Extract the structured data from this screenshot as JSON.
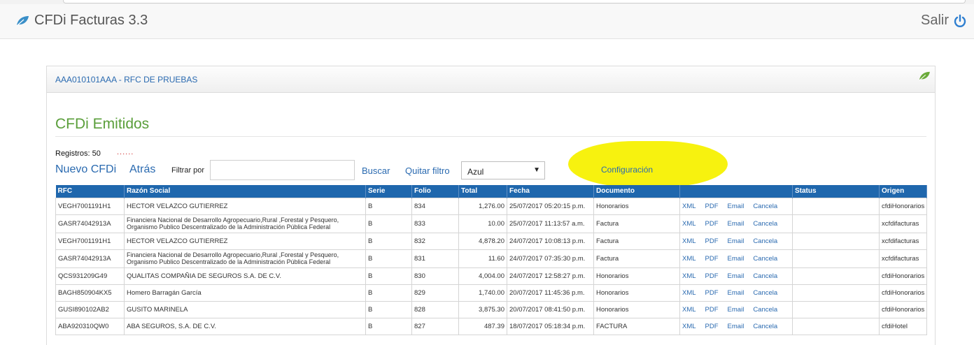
{
  "app": {
    "title": "CFDi Facturas 3.3",
    "logout_label": "Salir"
  },
  "panel": {
    "rfc_label": "AAA010101AAA - RFC DE PRUEBAS"
  },
  "section": {
    "title": "CFDi Emitidos",
    "registros": "Registros: 50",
    "dots": "......"
  },
  "toolbar": {
    "nuevo_label": "Nuevo CFDi",
    "atras_label": "Atrás",
    "filtrar_label": "Filtrar por",
    "filter_value": "",
    "buscar_label": "Buscar",
    "quitar_label": "Quitar filtro",
    "select_value": "Azul",
    "config_label": "Configuración"
  },
  "colors": {
    "accent": "#2a6ab0",
    "header_bg": "#1f67ad",
    "title_green": "#5a9e3a",
    "highlight": "#f7f20f"
  },
  "table": {
    "columns": [
      "RFC",
      "Razón Social",
      "Serie",
      "Folio",
      "Total",
      "Fecha",
      "Documento",
      "",
      "Status",
      "Origen"
    ],
    "actions": [
      "XML",
      "PDF",
      "Email",
      "Cancela"
    ],
    "rows": [
      {
        "rfc": "VEGH7001191H1",
        "razon": "HECTOR VELAZCO GUTIERREZ",
        "serie": "B",
        "folio": "834",
        "total": "1,276.00",
        "fecha": "25/07/2017 05:20:15 p.m.",
        "documento": "Honorarios",
        "status": "",
        "origen": "cfdiHonorarios"
      },
      {
        "rfc": "GASR74042913A",
        "razon": "Financiera Nacional de Desarrollo Agropecuario,Rural ,Forestal y Pesquero, Organismo Publico Descentralizado de la Administración Pública Federal",
        "serie": "B",
        "folio": "833",
        "total": "10.00",
        "fecha": "25/07/2017 11:13:57 a.m.",
        "documento": "Factura",
        "status": "",
        "origen": "xcfdifacturas"
      },
      {
        "rfc": "VEGH7001191H1",
        "razon": "HECTOR VELAZCO GUTIERREZ",
        "serie": "B",
        "folio": "832",
        "total": "4,878.20",
        "fecha": "24/07/2017 10:08:13 p.m.",
        "documento": "Factura",
        "status": "",
        "origen": "xcfdifacturas"
      },
      {
        "rfc": "GASR74042913A",
        "razon": "Financiera Nacional de Desarrollo Agropecuario,Rural ,Forestal y Pesquero, Organismo Publico Descentralizado de la Administración Pública Federal",
        "serie": "B",
        "folio": "831",
        "total": "11.60",
        "fecha": "24/07/2017 07:35:30 p.m.",
        "documento": "Factura",
        "status": "",
        "origen": "xcfdifacturas"
      },
      {
        "rfc": "QCS931209G49",
        "razon": "QUALITAS COMPAÑIA DE SEGUROS S.A. DE C.V.",
        "serie": "B",
        "folio": "830",
        "total": "4,004.00",
        "fecha": "24/07/2017 12:58:27 p.m.",
        "documento": "Honorarios",
        "status": "",
        "origen": "cfdiHonorarios"
      },
      {
        "rfc": "BAGH850904KX5",
        "razon": "Homero Barragán García",
        "serie": "B",
        "folio": "829",
        "total": "1,740.00",
        "fecha": "20/07/2017 11:45:36 p.m.",
        "documento": "Honorarios",
        "status": "",
        "origen": "cfdiHonorarios"
      },
      {
        "rfc": "GUSI890102AB2",
        "razon": "GUSITO MARINELA",
        "serie": "B",
        "folio": "828",
        "total": "3,875.30",
        "fecha": "20/07/2017 08:41:50 p.m.",
        "documento": "Honorarios",
        "status": "",
        "origen": "cfdiHonorarios"
      },
      {
        "rfc": "ABA920310QW0",
        "razon": "ABA SEGUROS, S.A. DE C.V.",
        "serie": "B",
        "folio": "827",
        "total": "487.39",
        "fecha": "18/07/2017 05:18:34 p.m.",
        "documento": "FACTURA",
        "status": "",
        "origen": "cfdiHotel"
      }
    ]
  }
}
